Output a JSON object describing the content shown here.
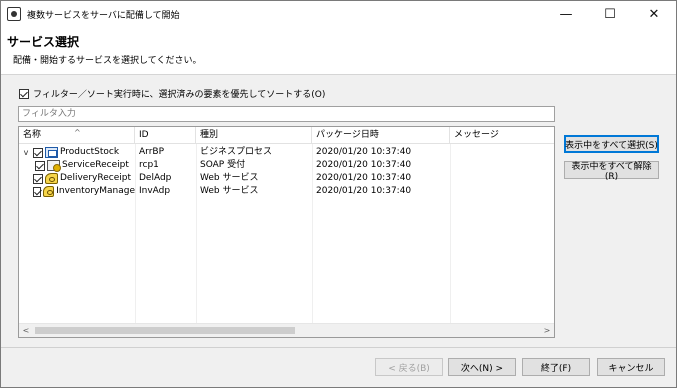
{
  "window": {
    "title": "複数サービスをサーバに配備して開始",
    "minimize_glyph": "—",
    "maximize_glyph": "☐",
    "close_glyph": "✕"
  },
  "header": {
    "title": "サービス選択",
    "description": "配備・開始するサービスを選択してください。"
  },
  "options": {
    "sort_selected_first": {
      "label": "フィルター／ソート実行時に、選択済みの要素を優先してソートする(O)",
      "checked": true
    }
  },
  "filter": {
    "placeholder": "フィルタ入力",
    "value": ""
  },
  "table": {
    "columns": {
      "name": "名称",
      "id": "ID",
      "type": "種別",
      "package_date": "パッケージ日時",
      "message": "メッセージ"
    },
    "rows": [
      {
        "name": "ProductStock",
        "id": "ArrBP",
        "type": "ビジネスプロセス",
        "package_date": "2020/01/20 10:37:40",
        "message": "",
        "expander": "v",
        "icon": "business-process-icon",
        "checked": true
      },
      {
        "name": "ServiceReceipt",
        "id": "rcp1",
        "type": "SOAP 受付",
        "package_date": "2020/01/20 10:37:40",
        "message": "",
        "icon": "service-receipt-icon",
        "checked": true
      },
      {
        "name": "DeliveryReceipt",
        "id": "DelAdp",
        "type": "Web サービス",
        "package_date": "2020/01/20 10:37:40",
        "message": "",
        "icon": "adapter-icon",
        "checked": true
      },
      {
        "name": "InventoryManage",
        "id": "InvAdp",
        "type": "Web サービス",
        "package_date": "2020/01/20 10:37:40",
        "message": "",
        "icon": "adapter-icon",
        "checked": true
      }
    ],
    "sort_caret": "^",
    "scroll_left_glyph": "<",
    "scroll_right_glyph": ">"
  },
  "side_buttons": {
    "select_all_visible": "表示中をすべて選択(S)",
    "deselect_all_visible": "表示中をすべて解除(R)"
  },
  "footer": {
    "back": "< 戻る(B)",
    "next": "次へ(N) >",
    "finish": "終了(F)",
    "cancel": "キャンセル"
  },
  "colors": {
    "accent": "#0078d7",
    "window_bg": "#f0f0f0"
  }
}
